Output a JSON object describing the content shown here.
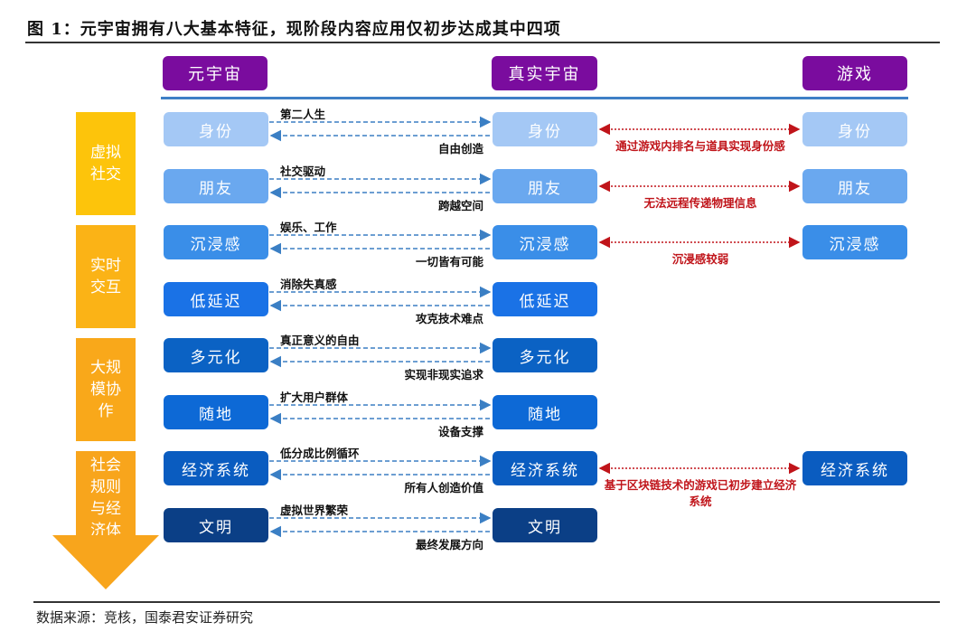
{
  "title": "图 1：元宇宙拥有八大基本特征，现阶段内容应用仅初步达成其中四项",
  "source": "数据来源：竞核，国泰君安证券研究",
  "headers": {
    "metaverse": "元宇宙",
    "real_universe": "真实宇宙",
    "game": "游戏"
  },
  "colors": {
    "header_purple": "#7a0c9e",
    "divider_blue": "#3f7fc6",
    "connector_blue": "#3b7fc4",
    "game_connector_red": "#c0141a",
    "stage_yellow_1": "#fdc40b",
    "stage_yellow_2": "#fbb316",
    "stage_orange_3": "#f9a81a",
    "stage_orange_4": "#f8a51c"
  },
  "stages": [
    {
      "label": "虚拟社交",
      "color": "#fdc40b"
    },
    {
      "label": "实时交互",
      "color": "#fbb316"
    },
    {
      "label": "大规模协作",
      "color": "#f9a81a"
    },
    {
      "label": "社会规则与经济体系",
      "color": "#f8a51c"
    }
  ],
  "features": [
    {
      "name": "身份",
      "color": "#a4c8f5",
      "forward": "第二人生",
      "backward": "自由创造",
      "game": "身份",
      "game_note": "通过游戏内排名与道具实现身份感"
    },
    {
      "name": "朋友",
      "color": "#6aa8ef",
      "forward": "社交驱动",
      "backward": "跨越空间",
      "game": "朋友",
      "game_note": "无法远程传递物理信息"
    },
    {
      "name": "沉浸感",
      "color": "#3a8ee8",
      "forward": "娱乐、工作",
      "backward": "一切皆有可能",
      "game": "沉浸感",
      "game_note": "沉浸感较弱"
    },
    {
      "name": "低延迟",
      "color": "#1a72e6",
      "forward": "消除失真感",
      "backward": "攻克技术难点",
      "game": null,
      "game_note": null
    },
    {
      "name": "多元化",
      "color": "#0b62c4",
      "forward": "真正意义的自由",
      "backward": "实现非现实追求",
      "game": null,
      "game_note": null
    },
    {
      "name": "随地",
      "color": "#0d69d6",
      "forward": "扩大用户群体",
      "backward": "设备支撑",
      "game": null,
      "game_note": null
    },
    {
      "name": "经济系统",
      "color": "#0a5cc0",
      "forward": "低分成比例循环",
      "backward": "所有人创造价值",
      "game": "经济系统",
      "game_note": "基于区块链技术的游戏已初步建立经济系统"
    },
    {
      "name": "文明",
      "color": "#0b3f86",
      "forward": "虚拟世界繁荣",
      "backward": "最终发展方向",
      "game": null,
      "game_note": null
    }
  ]
}
